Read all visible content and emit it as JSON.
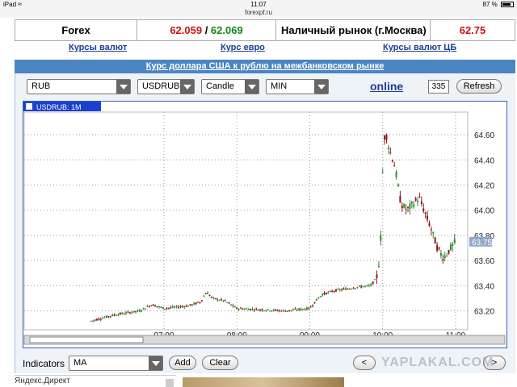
{
  "statusbar": {
    "device": "iPad",
    "time": "11:07",
    "battery": "87 %",
    "battery_level": 0.87
  },
  "url": "forexpf.ru",
  "rates": {
    "forex_label": "Forex",
    "forex_bid": "62.059",
    "separator": " / ",
    "forex_ask": "62.069",
    "cash_label": "Наличный рынок (г.Москва)",
    "cash_value": "62.75"
  },
  "links": [
    "Курсы валют",
    "Курс евро",
    "Курсы валют ЦБ"
  ],
  "panel_title": "Курс доллара США к рублю на межбанковском рынке",
  "controls": {
    "currency": "RUB",
    "pair": "USDRUB",
    "chart_type": "Candle",
    "interval": "MIN",
    "online": "online",
    "count": "335",
    "refresh": "Refresh"
  },
  "chart_data": {
    "type": "candlestick",
    "symbol_label": "USDRUB: 1M",
    "x_ticks": [
      "07:00",
      "08:00",
      "09:00",
      "10:00",
      "11:00"
    ],
    "y_ticks": [
      "63.20",
      "63.40",
      "63.60",
      "63.80",
      "64.00",
      "64.20",
      "64.40",
      "64.60"
    ],
    "ylim": [
      63.05,
      64.78
    ],
    "last_price": "63.75",
    "grid": true,
    "colors": {
      "up": "#2e8b2e",
      "down": "#8b1a1a",
      "last_badge": "#8fa8c8"
    },
    "path": [
      [
        "06:00",
        63.12
      ],
      [
        "06:20",
        63.17
      ],
      [
        "06:40",
        63.2
      ],
      [
        "06:50",
        63.25
      ],
      [
        "07:00",
        63.22
      ],
      [
        "07:20",
        63.24
      ],
      [
        "07:30",
        63.27
      ],
      [
        "07:35",
        63.35
      ],
      [
        "07:40",
        63.3
      ],
      [
        "07:50",
        63.28
      ],
      [
        "08:00",
        63.22
      ],
      [
        "08:20",
        63.21
      ],
      [
        "08:40",
        63.2
      ],
      [
        "09:00",
        63.22
      ],
      [
        "09:05",
        63.28
      ],
      [
        "09:10",
        63.33
      ],
      [
        "09:20",
        63.36
      ],
      [
        "09:40",
        63.39
      ],
      [
        "09:50",
        63.4
      ],
      [
        "09:55",
        63.46
      ],
      [
        "09:58",
        63.65
      ],
      [
        "10:00",
        64.3
      ],
      [
        "10:02",
        64.65
      ],
      [
        "10:05",
        64.5
      ],
      [
        "10:10",
        64.35
      ],
      [
        "10:15",
        64.05
      ],
      [
        "10:20",
        64.0
      ],
      [
        "10:30",
        64.1
      ],
      [
        "10:40",
        63.85
      ],
      [
        "10:45",
        63.7
      ],
      [
        "10:50",
        63.62
      ],
      [
        "11:00",
        63.75
      ]
    ]
  },
  "footer": {
    "indicators_label": "Indicators",
    "indicator_value": "MA",
    "add": "Add",
    "clear": "Clear",
    "prev": "<",
    "next": ">",
    "watermark": "YAPLAKAL.COM",
    "ad_text": "Яндекс.Директ"
  }
}
